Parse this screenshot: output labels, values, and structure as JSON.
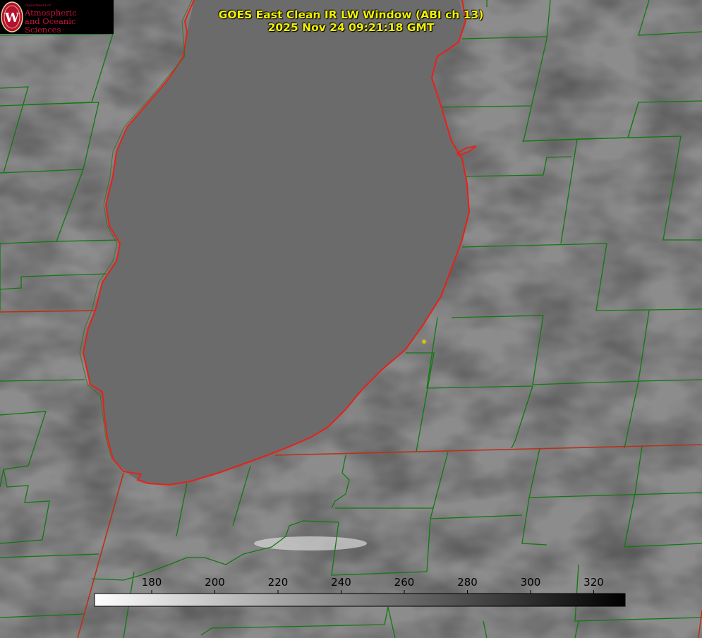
{
  "title": {
    "line1": "GOES East Clean IR LW Window (ABI ch 13)",
    "line2": "2025 Nov 24 09:21:18 GMT"
  },
  "logo": {
    "dept": "Department of",
    "line1": "Atmospheric",
    "line2": "and Oceanic Sciences",
    "seal_letter": "W"
  },
  "colorbar": {
    "ticks": [
      "180",
      "200",
      "220",
      "240",
      "260",
      "280",
      "300",
      "320"
    ],
    "min_color": "#ffffff",
    "max_color": "#000000"
  },
  "colors": {
    "lake": "#6b6b6b",
    "county_lines": "#0f7a0f",
    "state_lines": "#b8321a",
    "lake_outline": "#e8201a",
    "title": "#f2f200",
    "marker": "#d4c010"
  }
}
